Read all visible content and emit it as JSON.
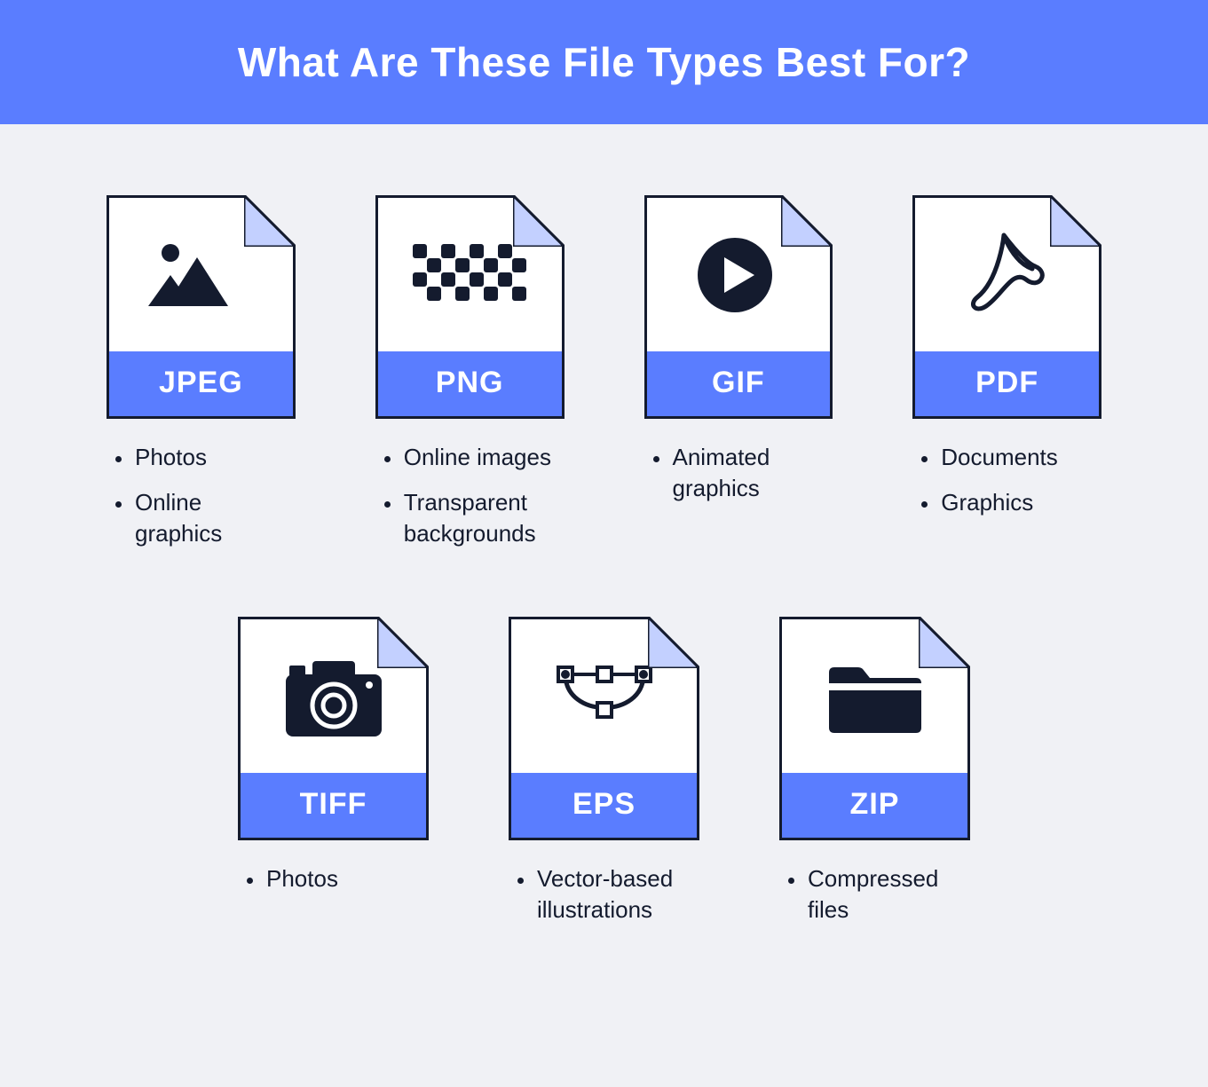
{
  "header": {
    "title": "What Are These File Types Best For?"
  },
  "file_types": [
    {
      "label": "JPEG",
      "icon": "image-icon",
      "uses": [
        "Photos",
        "Online graphics"
      ]
    },
    {
      "label": "PNG",
      "icon": "checker-icon",
      "uses": [
        "Online images",
        "Transparent backgrounds"
      ]
    },
    {
      "label": "GIF",
      "icon": "play-icon",
      "uses": [
        "Animated graphics"
      ]
    },
    {
      "label": "PDF",
      "icon": "pdf-icon",
      "uses": [
        "Documents",
        "Graphics"
      ]
    },
    {
      "label": "TIFF",
      "icon": "camera-icon",
      "uses": [
        "Photos"
      ]
    },
    {
      "label": "EPS",
      "icon": "vector-icon",
      "uses": [
        "Vector-based illustrations"
      ]
    },
    {
      "label": "ZIP",
      "icon": "folder-icon",
      "uses": [
        "Compressed files"
      ]
    }
  ],
  "layout": {
    "row1": 4,
    "row2": 3
  }
}
